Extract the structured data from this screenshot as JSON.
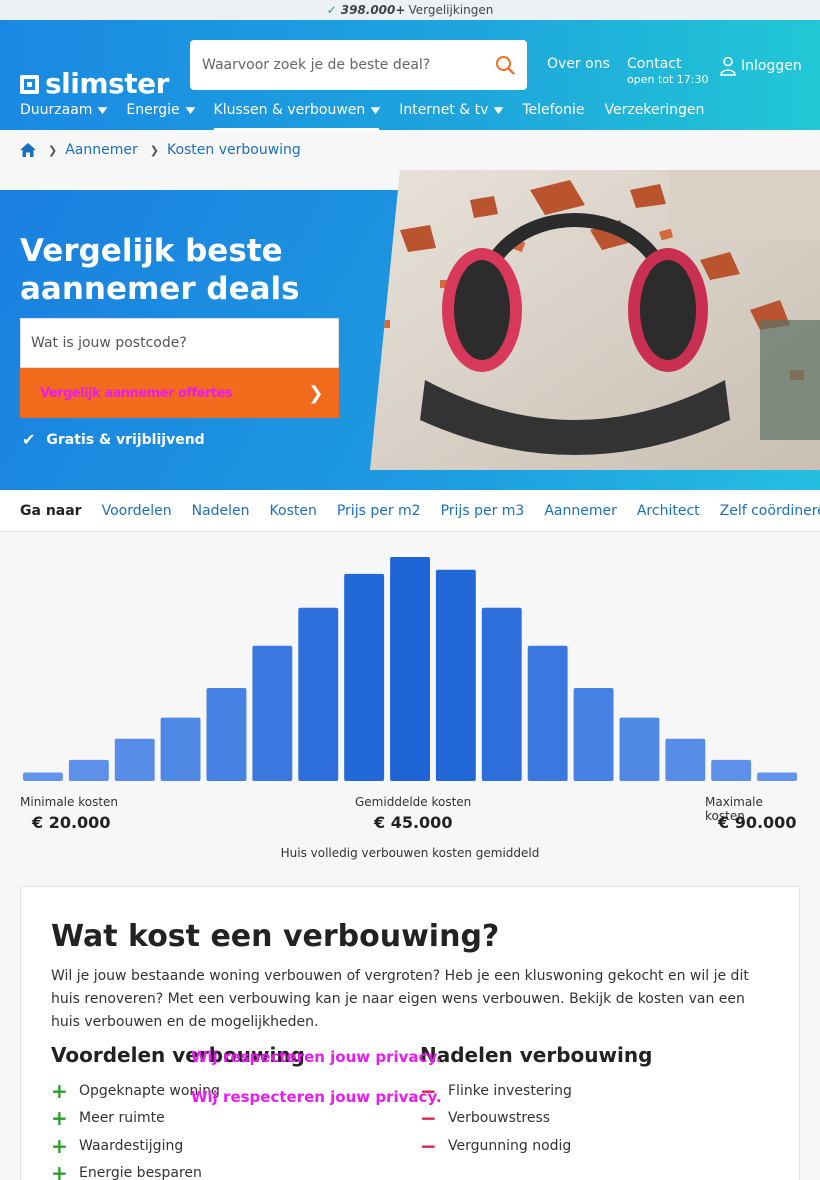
{
  "topbar": {
    "count": "398.000+",
    "label": "Vergelijkingen"
  },
  "header": {
    "logo": "slimster",
    "search_placeholder": "Waarvoor zoek je de beste deal?",
    "over_ons": "Over ons",
    "contact": "Contact",
    "contact_hours": "open tot 17:30",
    "login": "Inloggen"
  },
  "menu": [
    {
      "label": "Duurzaam",
      "dropdown": true
    },
    {
      "label": "Energie",
      "dropdown": true
    },
    {
      "label": "Klussen & verbouwen",
      "dropdown": true,
      "active": true
    },
    {
      "label": "Internet & tv",
      "dropdown": true
    },
    {
      "label": "Telefonie",
      "dropdown": false
    },
    {
      "label": "Verzekeringen",
      "dropdown": false
    }
  ],
  "breadcrumb": [
    "Aannemer",
    "Kosten verbouwing"
  ],
  "hero": {
    "title": "Vergelijk beste aannemer deals",
    "postcode_placeholder": "Wat is jouw postcode?",
    "cta": "Vergelijk aannemer offertes",
    "free": "Gratis & vrijblijvend"
  },
  "goto": {
    "label": "Ga naar",
    "links": [
      "Voordelen",
      "Nadelen",
      "Kosten",
      "Prijs per m2",
      "Prijs per m3",
      "Aannemer",
      "Architect",
      "Zelf coördineren"
    ]
  },
  "colors": {
    "accent": "#1a88e3",
    "cta": "#f26b1d",
    "plus": "#2a9e2a",
    "minus": "#d6204a"
  },
  "chart_data": {
    "type": "bar",
    "values": [
      2,
      5,
      10,
      15,
      22,
      32,
      41,
      49,
      53,
      50,
      41,
      32,
      22,
      15,
      10,
      5,
      2
    ],
    "ylim": [
      0,
      53
    ],
    "min_label": "Minimale kosten",
    "min_value": "€ 20.000",
    "avg_label": "Gemiddelde kosten",
    "avg_value": "€ 45.000",
    "max_label": "Maximale kosten",
    "max_value": "€ 90.000",
    "caption": "Huis volledig verbouwen kosten gemiddeld"
  },
  "article": {
    "title": "Wat kost een verbouwing?",
    "intro": "Wil je jouw bestaande woning verbouwen of vergroten? Heb je een kluswoning gekocht en wil je dit huis renoveren? Met een verbouwing kan je naar eigen wens verbouwen. Bekijk de kosten van een huis verbouwen en de mogelijkheden.",
    "pros_title": "Voordelen verbouwing",
    "pros": [
      "Opgeknapte woning",
      "Meer ruimte",
      "Waardestijging",
      "Energie besparen"
    ],
    "cons_title": "Nadelen verbouwing",
    "cons": [
      "Flinke investering",
      "Verbouwstress",
      "Vergunning nodig"
    ],
    "privacy": "Wij respecteren jouw privacy."
  }
}
